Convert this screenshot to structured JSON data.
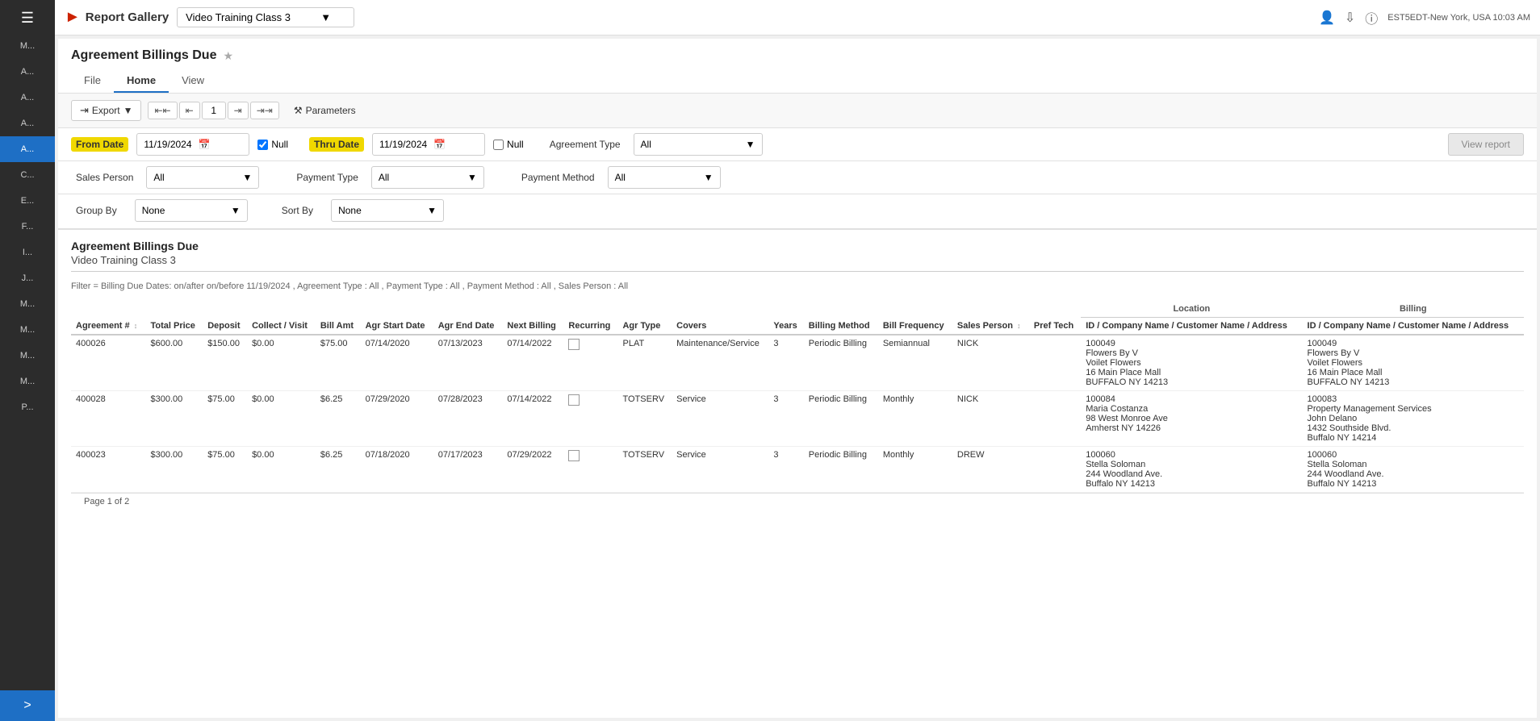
{
  "app": {
    "title": "Report Gallery",
    "logo_text": "Report Gallery",
    "selected_report": "Video Training Class 3",
    "timezone": "EST5EDT-New York, USA 10:03 AM"
  },
  "sidebar": {
    "items": [
      {
        "label": "M...",
        "active": false
      },
      {
        "label": "A...",
        "active": false
      },
      {
        "label": "A...",
        "active": false
      },
      {
        "label": "A...",
        "active": false
      },
      {
        "label": "A...",
        "active": true
      },
      {
        "label": "C...",
        "active": false
      },
      {
        "label": "E...",
        "active": false
      },
      {
        "label": "F...",
        "active": false
      },
      {
        "label": "I...",
        "active": false
      },
      {
        "label": "J...",
        "active": false
      },
      {
        "label": "M...",
        "active": false
      },
      {
        "label": "M...",
        "active": false
      },
      {
        "label": "M...",
        "active": false
      },
      {
        "label": "M...",
        "active": false
      },
      {
        "label": "P...",
        "active": false
      }
    ],
    "expand_label": ">"
  },
  "tabs": [
    {
      "label": "File",
      "active": false
    },
    {
      "label": "Home",
      "active": true
    },
    {
      "label": "View",
      "active": false
    }
  ],
  "toolbar": {
    "export_label": "Export",
    "params_label": "Parameters",
    "page_current": "1"
  },
  "parameters": {
    "from_date_label": "From Date",
    "from_date_value": "11/19/2024",
    "from_date_null_checked": true,
    "thru_date_label": "Thru Date",
    "thru_date_value": "11/19/2024",
    "thru_date_null_checked": false,
    "agreement_type_label": "Agreement Type",
    "agreement_type_value": "All",
    "sales_person_label": "Sales Person",
    "sales_person_value": "All",
    "payment_type_label": "Payment Type",
    "payment_type_value": "All",
    "payment_method_label": "Payment Method",
    "payment_method_value": "All",
    "group_by_label": "Group By",
    "group_by_value": "None",
    "sort_by_label": "Sort By",
    "sort_by_value": "None",
    "view_report_label": "View report"
  },
  "report": {
    "title": "Agreement Billings Due",
    "subtitle": "Video Training Class 3",
    "filter_text": "Filter = Billing Due Dates: on/after  on/before 11/19/2024 , Agreement Type : All , Payment Type : All , Payment Method : All , Sales Person : All",
    "location_group": "Location",
    "billing_group": "Billing",
    "columns": [
      "Agreement #",
      "Total Price",
      "Deposit",
      "Collect / Visit",
      "Bill Amt",
      "Agr Start Date",
      "Agr End Date",
      "Next Billing",
      "Recurring",
      "Agr Type",
      "Covers",
      "Years",
      "Billing Method",
      "Bill Frequency",
      "Sales Person",
      "Pref Tech",
      "ID / Company Name / Customer Name / Address",
      "ID / Company Name / Customer Name / Address"
    ],
    "rows": [
      {
        "agreement_num": "400026",
        "total_price": "$600.00",
        "deposit": "$150.00",
        "collect_visit": "$0.00",
        "bill_amt": "$75.00",
        "agr_start_date": "07/14/2020",
        "agr_end_date": "07/13/2023",
        "next_billing": "07/14/2022",
        "recurring": false,
        "agr_type": "PLAT",
        "covers": "Maintenance/Service",
        "years": "3",
        "billing_method": "Periodic Billing",
        "bill_frequency": "Semiannual",
        "sales_person": "NICK",
        "pref_tech": "",
        "location_id": "100049",
        "location_company": "Flowers By V",
        "location_name": "Voilet Flowers",
        "location_address": "16 Main Place Mall",
        "location_city_state_zip": "BUFFALO NY 14213",
        "billing_id": "100049",
        "billing_company": "Flowers By V",
        "billing_name": "Voilet Flowers",
        "billing_address": "16 Main Place Mall",
        "billing_city_state_zip": "BUFFALO NY 14213"
      },
      {
        "agreement_num": "400028",
        "total_price": "$300.00",
        "deposit": "$75.00",
        "collect_visit": "$0.00",
        "bill_amt": "$6.25",
        "agr_start_date": "07/29/2020",
        "agr_end_date": "07/28/2023",
        "next_billing": "07/14/2022",
        "recurring": false,
        "agr_type": "TOTSERV",
        "covers": "Service",
        "years": "3",
        "billing_method": "Periodic Billing",
        "bill_frequency": "Monthly",
        "sales_person": "NICK",
        "pref_tech": "",
        "location_id": "100084",
        "location_company": "",
        "location_name": "Maria Costanza",
        "location_address": "98 West Monroe Ave",
        "location_city_state_zip": "Amherst NY 14226",
        "billing_id": "100083",
        "billing_company": "Property Management Services",
        "billing_name": "John Delano",
        "billing_address": "1432 Southside Blvd.",
        "billing_city_state_zip": "Buffalo NY 14214"
      },
      {
        "agreement_num": "400023",
        "total_price": "$300.00",
        "deposit": "$75.00",
        "collect_visit": "$0.00",
        "bill_amt": "$6.25",
        "agr_start_date": "07/18/2020",
        "agr_end_date": "07/17/2023",
        "next_billing": "07/29/2022",
        "recurring": false,
        "agr_type": "TOTSERV",
        "covers": "Service",
        "years": "3",
        "billing_method": "Periodic Billing",
        "bill_frequency": "Monthly",
        "sales_person": "DREW",
        "pref_tech": "",
        "location_id": "100060",
        "location_company": "",
        "location_name": "Stella Soloman",
        "location_address": "244 Woodland Ave.",
        "location_city_state_zip": "Buffalo NY 14213",
        "billing_id": "100060",
        "billing_company": "",
        "billing_name": "Stella Soloman",
        "billing_address": "244 Woodland Ave.",
        "billing_city_state_zip": "Buffalo NY 14213"
      }
    ],
    "page_info": "Page 1 of 2"
  }
}
